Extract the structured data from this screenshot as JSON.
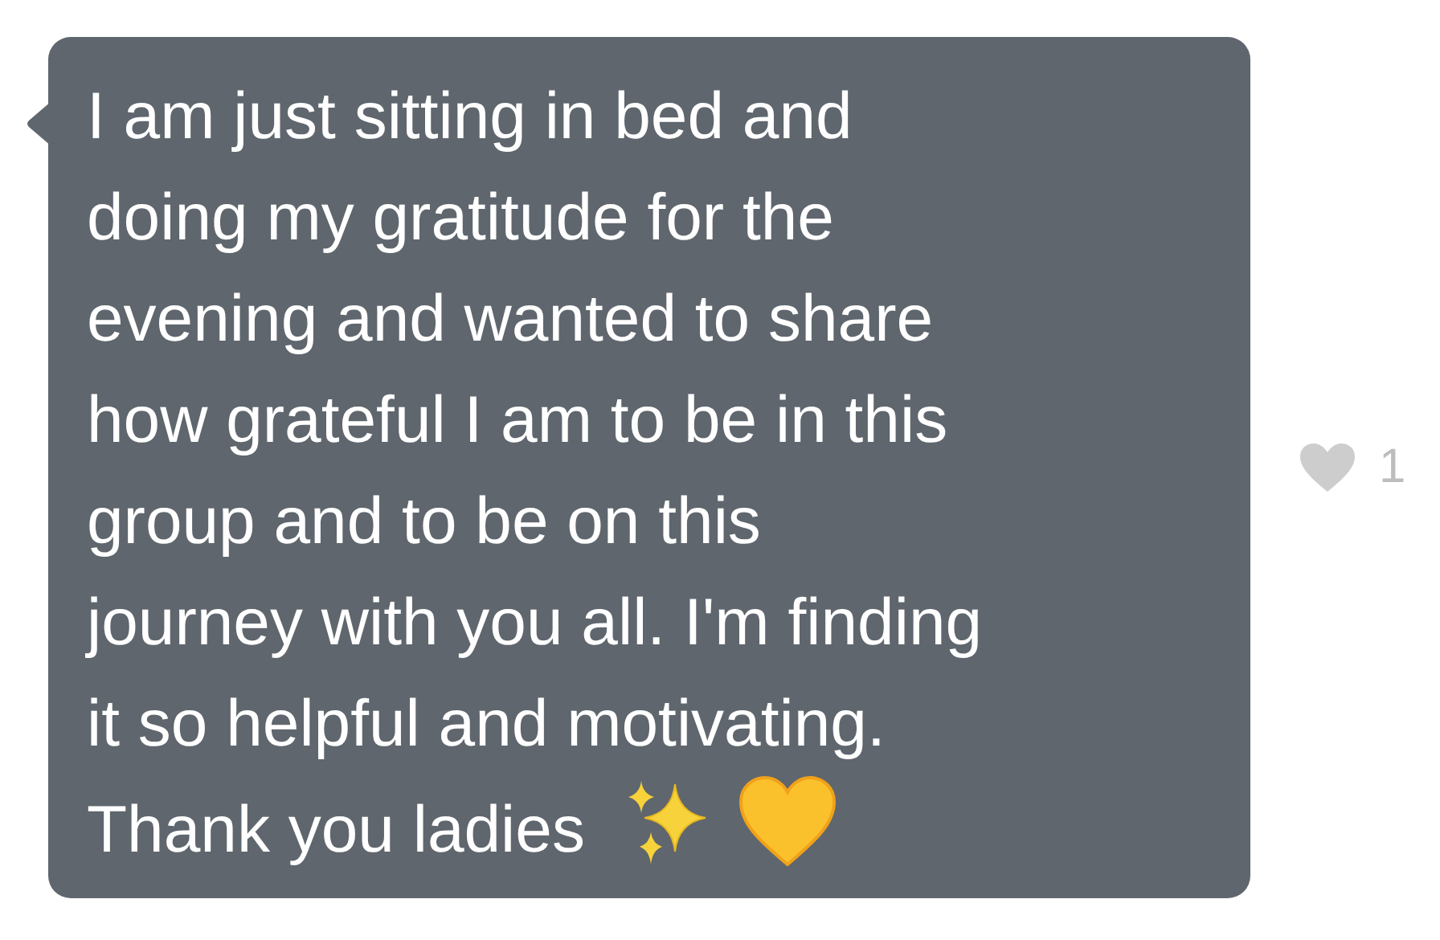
{
  "message": {
    "lines": [
      "I am just sitting in bed and",
      "doing my gratitude for the",
      "evening and wanted to share",
      "how grateful I am to be in this",
      "group and to be on this",
      "journey with you all. I'm finding",
      "it so helpful and motivating.",
      "Thank you ladies"
    ]
  },
  "reaction": {
    "count": "1"
  }
}
